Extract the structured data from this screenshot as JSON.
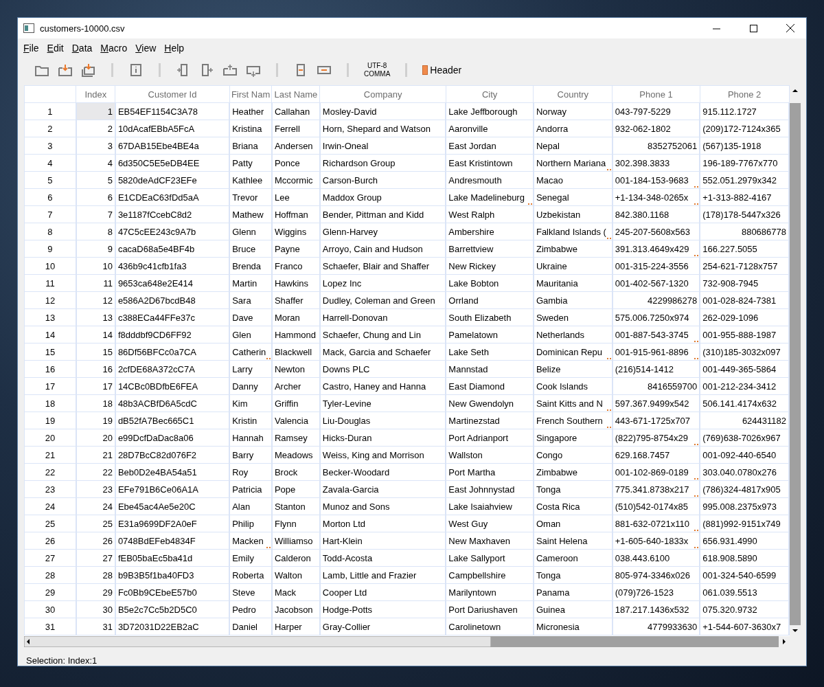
{
  "window": {
    "title": "customers-10000.csv"
  },
  "menu": [
    "File",
    "Edit",
    "Data",
    "Macro",
    "View",
    "Help"
  ],
  "toolbar": {
    "encoding": "UTF-8",
    "delimiter": "COMMA",
    "header": {
      "label": "Header",
      "on": true
    }
  },
  "table": {
    "columns": [
      "Index",
      "Customer Id",
      "First Nam",
      "Last Name",
      "Company",
      "City",
      "Country",
      "Phone 1",
      "Phone 2"
    ],
    "rows": [
      {
        "number": "1",
        "selected": true,
        "cells": [
          "1",
          "EB54EF1154C3A78",
          "Heather",
          "Callahan",
          "Mosley-David",
          "Lake Jeffborough",
          "Norway",
          "043-797-5229",
          "915.112.1727"
        ]
      },
      {
        "number": "2",
        "selected": false,
        "cells": [
          "2",
          "10dAcafEBbA5FcA",
          "Kristina",
          "Ferrell",
          "Horn, Shepard and Watson",
          "Aaronville",
          "Andorra",
          "932-062-1802",
          "(209)172-7124x365"
        ]
      },
      {
        "number": "3",
        "selected": false,
        "cells": [
          "3",
          "67DAB15Ebe4BE4a",
          "Briana",
          "Andersen",
          "Irwin-Oneal",
          "East Jordan",
          "Nepal",
          "8352752061",
          "(567)135-1918"
        ]
      },
      {
        "number": "4",
        "selected": false,
        "cells": [
          "4",
          "6d350C5E5eDB4EE",
          "Patty",
          "Ponce",
          "Richardson Group",
          "East Kristintown",
          {
            "text": "Northern Mariana",
            "overflow": true
          },
          "302.398.3833",
          "196-189-7767x770"
        ]
      },
      {
        "number": "5",
        "selected": false,
        "cells": [
          "5",
          "5820deAdCF23EFe",
          "Kathlee",
          "Mccormic",
          "Carson-Burch",
          "Andresmouth",
          "Macao",
          {
            "text": "001-184-153-9683",
            "overflow": true
          },
          "552.051.2979x342"
        ]
      },
      {
        "number": "6",
        "selected": false,
        "cells": [
          "6",
          "E1CDEaC63fDd5aA",
          "Trevor",
          "Lee",
          "Maddox Group",
          {
            "text": "Lake Madelineburg",
            "overflow": true
          },
          "Senegal",
          {
            "text": "+1-134-348-0265x",
            "overflow": true
          },
          "+1-313-882-4167"
        ]
      },
      {
        "number": "7",
        "selected": false,
        "cells": [
          "7",
          "3e1187fCcebC8d2",
          "Mathew",
          "Hoffman",
          "Bender, Pittman and Kidd",
          "West Ralph",
          "Uzbekistan",
          "842.380.1168",
          "(178)178-5447x326"
        ]
      },
      {
        "number": "8",
        "selected": false,
        "cells": [
          "8",
          "47C5cEE243c9A7b",
          "Glenn",
          "Wiggins",
          "Glenn-Harvey",
          "Ambershire",
          {
            "text": "Falkland Islands (",
            "overflow": true
          },
          "245-207-5608x563",
          "880686778"
        ]
      },
      {
        "number": "9",
        "selected": false,
        "cells": [
          "9",
          "cacaD68a5e4BF4b",
          "Bruce",
          "Payne",
          "Arroyo, Cain and Hudson",
          "Barrettview",
          "Zimbabwe",
          {
            "text": "391.313.4649x429",
            "overflow": true
          },
          "166.227.5055"
        ]
      },
      {
        "number": "10",
        "selected": false,
        "cells": [
          "10",
          "436b9c41cfb1fa3",
          "Brenda",
          "Franco",
          "Schaefer, Blair and Shaffer",
          "New Rickey",
          "Ukraine",
          "001-315-224-3556",
          "254-621-7128x757"
        ]
      },
      {
        "number": "11",
        "selected": false,
        "cells": [
          "11",
          "9653ca648e2E414",
          "Martin",
          "Hawkins",
          "Lopez Inc",
          "Lake Bobton",
          "Mauritania",
          "001-402-567-1320",
          "732-908-7945"
        ]
      },
      {
        "number": "12",
        "selected": false,
        "cells": [
          "12",
          "e586A2D67bcdB48",
          "Sara",
          "Shaffer",
          "Dudley, Coleman and Green",
          "Orrland",
          "Gambia",
          "4229986278",
          "001-028-824-7381"
        ]
      },
      {
        "number": "13",
        "selected": false,
        "cells": [
          "13",
          "c388ECa44FFe37c",
          "Dave",
          "Moran",
          "Harrell-Donovan",
          "South Elizabeth",
          "Sweden",
          "575.006.7250x974",
          "262-029-1096"
        ]
      },
      {
        "number": "14",
        "selected": false,
        "cells": [
          "14",
          "f8dddbf9CD6FF92",
          "Glen",
          "Hammond",
          "Schaefer, Chung and Lin",
          "Pamelatown",
          "Netherlands",
          {
            "text": "001-887-543-3745",
            "overflow": true
          },
          "001-955-888-1987"
        ]
      },
      {
        "number": "15",
        "selected": false,
        "cells": [
          "15",
          "86Df56BFCc0a7CA",
          {
            "text": "Catherin",
            "overflow": true
          },
          "Blackwell",
          "Mack, Garcia and Schaefer",
          "Lake Seth",
          {
            "text": "Dominican Repu",
            "overflow": true
          },
          {
            "text": "001-915-961-8896",
            "overflow": true
          },
          "(310)185-3032x097"
        ]
      },
      {
        "number": "16",
        "selected": false,
        "cells": [
          "16",
          "2cfDE68A372cC7A",
          "Larry",
          "Newton",
          "Downs PLC",
          "Mannstad",
          "Belize",
          "(216)514-1412",
          "001-449-365-5864"
        ]
      },
      {
        "number": "17",
        "selected": false,
        "cells": [
          "17",
          "14CBc0BDfbE6FEA",
          "Danny",
          "Archer",
          "Castro, Haney and Hanna",
          "East Diamond",
          "Cook Islands",
          "8416559700",
          "001-212-234-3412"
        ]
      },
      {
        "number": "18",
        "selected": false,
        "cells": [
          "18",
          "48b3ACBfD6A5cdC",
          "Kim",
          "Griffin",
          "Tyler-Levine",
          "New Gwendolyn",
          {
            "text": "Saint Kitts and N",
            "overflow": true
          },
          "597.367.9499x542",
          "506.141.4174x632"
        ]
      },
      {
        "number": "19",
        "selected": false,
        "cells": [
          "19",
          "dB52fA7Bec665C1",
          "Kristin",
          "Valencia",
          "Liu-Douglas",
          "Martinezstad",
          {
            "text": "French Southern",
            "overflow": true
          },
          "443-671-1725x707",
          "624431182"
        ]
      },
      {
        "number": "20",
        "selected": false,
        "cells": [
          "20",
          "e99DcfDaDac8a06",
          "Hannah",
          "Ramsey",
          "Hicks-Duran",
          "Port Adrianport",
          "Singapore",
          {
            "text": "(822)795-8754x29",
            "overflow": true
          },
          "(769)638-7026x967"
        ]
      },
      {
        "number": "21",
        "selected": false,
        "cells": [
          "21",
          "28D7BcC82d076F2",
          "Barry",
          "Meadows",
          "Weiss, King and Morrison",
          "Wallston",
          "Congo",
          "629.168.7457",
          "001-092-440-6540"
        ]
      },
      {
        "number": "22",
        "selected": false,
        "cells": [
          "22",
          "Beb0D2e4BA54a51",
          "Roy",
          "Brock",
          "Becker-Woodard",
          "Port Martha",
          "Zimbabwe",
          {
            "text": "001-102-869-0189",
            "overflow": true
          },
          "303.040.0780x276"
        ]
      },
      {
        "number": "23",
        "selected": false,
        "cells": [
          "23",
          "EFe791B6Ce06A1A",
          "Patricia",
          "Pope",
          "Zavala-Garcia",
          "East Johnnystad",
          "Tonga",
          {
            "text": "775.341.8738x217",
            "overflow": true
          },
          "(786)324-4817x905"
        ]
      },
      {
        "number": "24",
        "selected": false,
        "cells": [
          "24",
          "Ebe45ac4Ae5e20C",
          "Alan",
          "Stanton",
          "Munoz and Sons",
          "Lake Isaiahview",
          "Costa Rica",
          "(510)542-0174x85",
          "995.008.2375x973"
        ]
      },
      {
        "number": "25",
        "selected": false,
        "cells": [
          "25",
          "E31a9699DF2A0eF",
          "Philip",
          "Flynn",
          "Morton Ltd",
          "West Guy",
          "Oman",
          {
            "text": "881-632-0721x110",
            "overflow": true
          },
          "(881)992-9151x749"
        ]
      },
      {
        "number": "26",
        "selected": false,
        "cells": [
          "26",
          "0748BdEFeb4834F",
          {
            "text": "Macken",
            "overflow": true
          },
          "Williamso",
          "Hart-Klein",
          "New Maxhaven",
          "Saint Helena",
          {
            "text": "+1-605-640-1833x",
            "overflow": true
          },
          "656.931.4990"
        ]
      },
      {
        "number": "27",
        "selected": false,
        "cells": [
          "27",
          "fEB05baEc5ba41d",
          "Emily",
          "Calderon",
          "Todd-Acosta",
          "Lake Sallyport",
          "Cameroon",
          "038.443.6100",
          "618.908.5890"
        ]
      },
      {
        "number": "28",
        "selected": false,
        "cells": [
          "28",
          "b9B3B5f1ba40FD3",
          "Roberta",
          "Walton",
          "Lamb, Little and Frazier",
          "Campbellshire",
          "Tonga",
          "805-974-3346x026",
          "001-324-540-6599"
        ]
      },
      {
        "number": "29",
        "selected": false,
        "cells": [
          "29",
          "Fc0Bb9CEbeE57b0",
          "Steve",
          "Mack",
          "Cooper Ltd",
          "Marilyntown",
          "Panama",
          "(079)726-1523",
          "061.039.5513"
        ]
      },
      {
        "number": "30",
        "selected": false,
        "cells": [
          "30",
          "B5e2c7Cc5b2D5C0",
          "Pedro",
          "Jacobson",
          "Hodge-Potts",
          "Port Dariushaven",
          "Guinea",
          "187.217.1436x532",
          "075.320.9732"
        ]
      },
      {
        "number": "31",
        "selected": false,
        "cells": [
          "31",
          "3D72031D22EB2aC",
          "Daniel",
          "Harper",
          "Gray-Collier",
          "Carolinetown",
          "Micronesia",
          "4779933630",
          "+1-544-607-3630x7"
        ]
      }
    ]
  },
  "status_bar": "Selection: Index:1"
}
